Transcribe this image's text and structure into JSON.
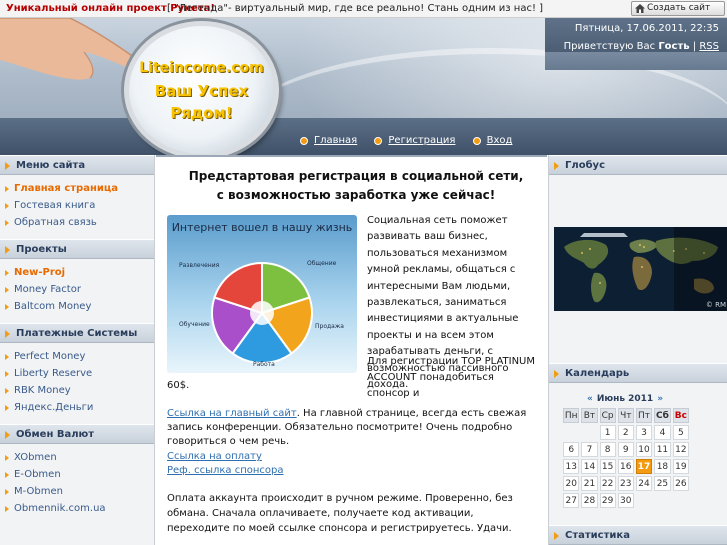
{
  "topbar": {
    "promo_title": "Уникальный онлайн проект Рунета!",
    "promo_text": "[ \"Легенда\"- виртуальный мир, где все реально! Стань одним из нас! ]",
    "create_site": "Создать сайт"
  },
  "header": {
    "date": "Пятница, 17.06.2011, 22:35",
    "greeting_prefix": "Приветствую Вас",
    "guest": "Гость",
    "sep": " | ",
    "rss": "RSS",
    "logo_site": "Liteincome.com",
    "slogan_line1": "Ваш Успех",
    "slogan_line2": "Рядом!"
  },
  "nav": [
    "Главная",
    "Регистрация",
    "Вход"
  ],
  "left": {
    "site_menu_title": "Меню сайта",
    "site_menu": [
      "Главная страница",
      "Гостевая книга",
      "Обратная связь"
    ],
    "projects_title": "Проекты",
    "projects": [
      "New-Proj",
      "Money Factor",
      "Baltcom Money"
    ],
    "payments_title": "Платежные Системы",
    "payments": [
      "Perfect Money",
      "Liberty Reserve",
      "RBK Money",
      "Яндекс.Деньги"
    ],
    "exchange_title": "Обмен Валют",
    "exchange": [
      "XObmen",
      "E-Obmen",
      "M-Obmen",
      "Obmennik.com.ua"
    ]
  },
  "center": {
    "title": "Предстартовая регистрация в социальной сети, с возможностью заработка уже сейчас!",
    "image": {
      "title": "Интернет вошел в нашу жизнь",
      "labels": [
        "Развлечения",
        "Общение",
        "Обучение",
        "Продажа",
        "Работа"
      ]
    },
    "intro": "Социальная сеть поможет развивать ваш бизнес, пользоваться механизмом умной рекламы, общаться с интересными Вам людьми, развлекаться, заниматься инвестициями в актуальные проекты и на всем этом зарабатывать деньги, с возможностью пассивного дохода.",
    "reg_text": "Для регистрации TOP PLATINUM ACCOUNT понадобиться спонсор и",
    "reg_tail": "60$.",
    "main_link": "Ссылка на главный сайт",
    "main_link_text": ". На главной странице, всегда есть свежая запись конференции. Обязательно посмотрите! Очень подробно говориться о чем речь.",
    "pay_link": "Ссылка на оплату",
    "ref_link": "Реф. ссылка спонсора",
    "payment_note": "Оплата аккаунта происходит в ручном режиме. Проверенно, без обмана. Сначала оплачиваете, получаете код активации, переходите по моей ссылке спонсора и регистрируетесь. Удачи."
  },
  "right": {
    "globe_title": "Глобус",
    "globe_copyright": "© RM",
    "calendar_title": "Календарь",
    "stats_title": "Статистика",
    "calendar": {
      "month": "Июнь 2011",
      "prev": "«",
      "next": "»",
      "weekdays": [
        "Пн",
        "Вт",
        "Ср",
        "Чт",
        "Пт",
        "Сб",
        "Вс"
      ],
      "weeks": [
        [
          "",
          "",
          "1",
          "2",
          "3",
          "4",
          "5"
        ],
        [
          "6",
          "7",
          "8",
          "9",
          "10",
          "11",
          "12"
        ],
        [
          "13",
          "14",
          "15",
          "16",
          "17",
          "18",
          "19"
        ],
        [
          "20",
          "21",
          "22",
          "23",
          "24",
          "25",
          "26"
        ],
        [
          "27",
          "28",
          "29",
          "30",
          "",
          "",
          ""
        ]
      ],
      "today": "17"
    }
  },
  "colors": {
    "accent_orange": "#f39c12",
    "link_blue": "#2f6fb0",
    "promo_red": "#b40000",
    "header_dark": "#3f5168"
  }
}
